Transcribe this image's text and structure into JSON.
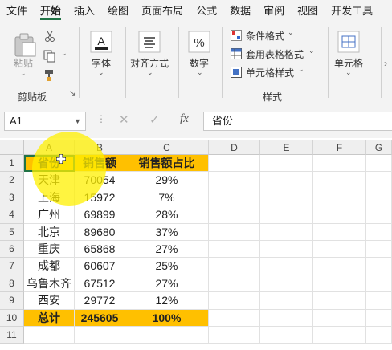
{
  "tabs": [
    "文件",
    "开始",
    "插入",
    "绘图",
    "页面布局",
    "公式",
    "数据",
    "审阅",
    "视图",
    "开发工具"
  ],
  "active_tab": "开始",
  "ribbon": {
    "paste_label": "粘贴",
    "clipboard_group": "剪贴板",
    "font_label": "字体",
    "align_label": "对齐方式",
    "number_label": "数字",
    "cond_format": "条件格式",
    "table_format": "套用表格格式",
    "cell_style": "单元格样式",
    "styles_group": "样式",
    "cells_label": "单元格"
  },
  "formula_bar": {
    "name_box": "A1",
    "content": "省份",
    "fx": "fx"
  },
  "columns": [
    "A",
    "B",
    "C",
    "D",
    "E",
    "F",
    "G"
  ],
  "rows": [
    "1",
    "2",
    "3",
    "4",
    "5",
    "6",
    "7",
    "8",
    "9",
    "10",
    "11"
  ],
  "table": {
    "headers": [
      "省份",
      "销售额",
      "销售额占比"
    ],
    "data": [
      [
        "天津",
        "70054",
        "29%"
      ],
      [
        "上海",
        "15972",
        "7%"
      ],
      [
        "广州",
        "69899",
        "28%"
      ],
      [
        "北京",
        "89680",
        "37%"
      ],
      [
        "重庆",
        "65868",
        "27%"
      ],
      [
        "成都",
        "60607",
        "25%"
      ],
      [
        "乌鲁木齐",
        "67512",
        "27%"
      ],
      [
        "西安",
        "29772",
        "12%"
      ]
    ],
    "total": [
      "总计",
      "245605",
      "100%"
    ]
  },
  "colors": {
    "highlight": "#ffc000",
    "accent": "#217346"
  }
}
